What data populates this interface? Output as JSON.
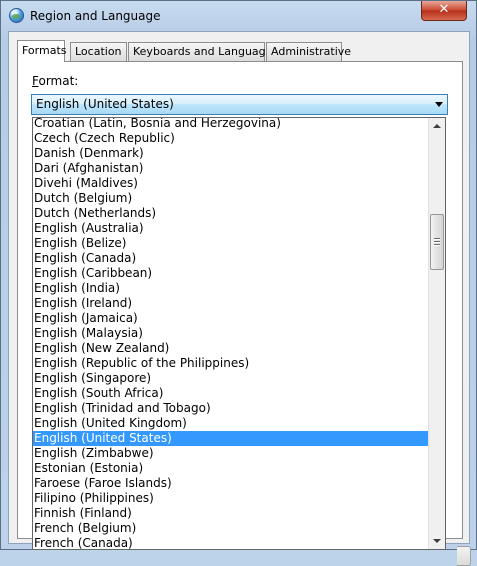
{
  "window": {
    "title": "Region and Language",
    "icon": "globe-icon",
    "close_glyph": "✕"
  },
  "tabs": [
    {
      "label": "Formats",
      "active": true
    },
    {
      "label": "Location",
      "active": false
    },
    {
      "label": "Keyboards and Languages",
      "active": false
    },
    {
      "label": "Administrative",
      "active": false
    }
  ],
  "format": {
    "label_first": "F",
    "label_rest": "ormat:",
    "selected_value": "English (United States)"
  },
  "dropdown": {
    "items": [
      "Croatian (Latin, Bosnia and Herzegovina)",
      "Czech (Czech Republic)",
      "Danish (Denmark)",
      "Dari (Afghanistan)",
      "Divehi (Maldives)",
      "Dutch (Belgium)",
      "Dutch (Netherlands)",
      "English (Australia)",
      "English (Belize)",
      "English (Canada)",
      "English (Caribbean)",
      "English (India)",
      "English (Ireland)",
      "English (Jamaica)",
      "English (Malaysia)",
      "English (New Zealand)",
      "English (Republic of the Philippines)",
      "English (Singapore)",
      "English (South Africa)",
      "English (Trinidad and Tobago)",
      "English (United Kingdom)",
      "English (United States)",
      "English (Zimbabwe)",
      "Estonian (Estonia)",
      "Faroese (Faroe Islands)",
      "Filipino (Philippines)",
      "Finnish (Finland)",
      "French (Belgium)",
      "French (Canada)"
    ],
    "selected_index": 21
  },
  "colors": {
    "selection": "#3399ff",
    "close_button": "#c8442d",
    "combo_border": "#3c7fb1"
  }
}
